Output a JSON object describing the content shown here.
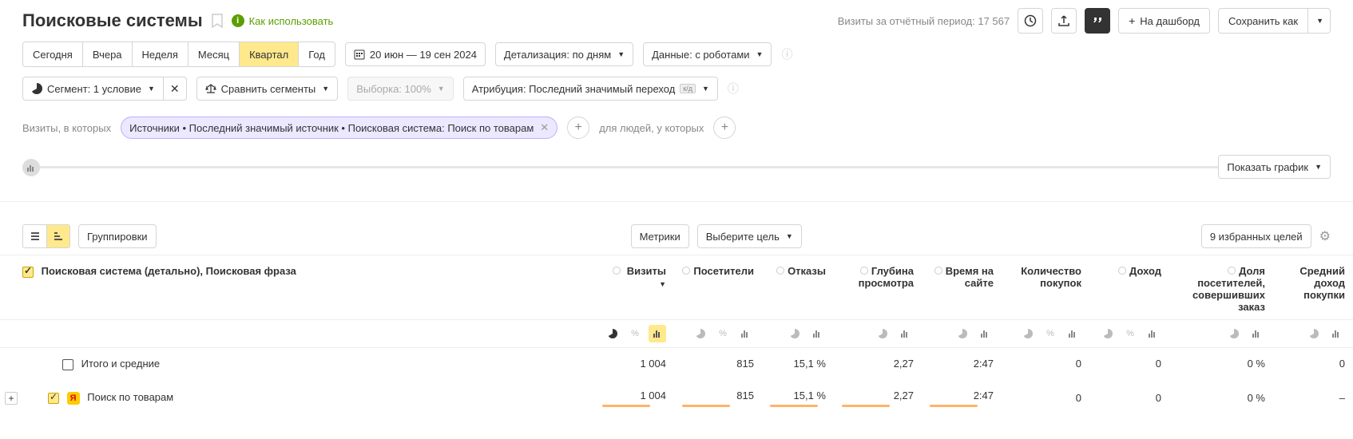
{
  "header": {
    "title": "Поисковые системы",
    "how_to": "Как использовать",
    "period_label": "Визиты за отчётный период:",
    "period_value": "17 567",
    "add_dashboard": "На дашборд",
    "save_as": "Сохранить как"
  },
  "periods": {
    "today": "Сегодня",
    "yesterday": "Вчера",
    "week": "Неделя",
    "month": "Месяц",
    "quarter": "Квартал",
    "year": "Год"
  },
  "date_range": "20 июн — 19 сен 2024",
  "detail": "Детализация: по дням",
  "data_mode": "Данные: с роботами",
  "segment": "Сегмент: 1 условие",
  "compare": "Сравнить сегменты",
  "sampling": "Выборка: 100%",
  "attribution": "Атрибуция: Последний значимый переход",
  "attribution_badge": "к/д",
  "filter": {
    "label1": "Визиты, в которых",
    "chip": "Источники • Последний значимый источник • Поисковая система: Поиск по товарам",
    "label2": "для людей, у которых"
  },
  "show_graph": "Показать график",
  "table_controls": {
    "groupings": "Группировки",
    "metrics": "Метрики",
    "choose_goal": "Выберите цель",
    "favorites": "9 избранных целей"
  },
  "columns": {
    "col0": "Поисковая система (детально), Поисковая фраза",
    "visits": "Визиты",
    "visitors": "Посетители",
    "bounces": "Отказы",
    "depth": "Глубина просмотра",
    "time": "Время на сайте",
    "purchases": "Количество покупок",
    "income": "Доход",
    "share": "Доля посетителей, совершивших заказ",
    "avg_income": "Средний доход покупки"
  },
  "rows": {
    "total_label": "Итого и средние",
    "row1_label": "Поиск по товарам",
    "total": {
      "visits": "1 004",
      "visitors": "815",
      "bounces": "15,1 %",
      "depth": "2,27",
      "time": "2:47",
      "purchases": "0",
      "income": "0",
      "share": "0 %",
      "avg_income": "0"
    },
    "row1": {
      "visits": "1 004",
      "visitors": "815",
      "bounces": "15,1 %",
      "depth": "2,27",
      "time": "2:47",
      "purchases": "0",
      "income": "0",
      "share": "0 %",
      "avg_income": "–"
    }
  }
}
